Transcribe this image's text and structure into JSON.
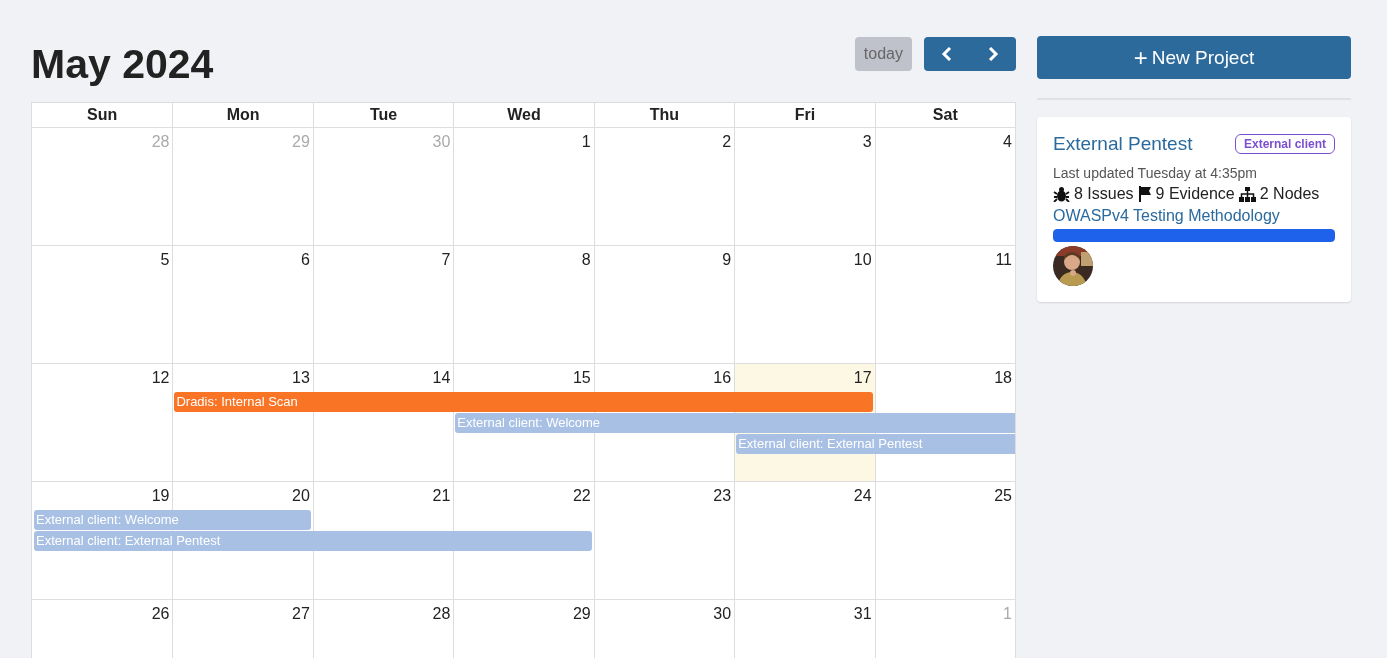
{
  "calendar": {
    "title": "May 2024",
    "today_button": {
      "label": "today",
      "disabled": true
    },
    "weekdays": [
      "Sun",
      "Mon",
      "Tue",
      "Wed",
      "Thu",
      "Fri",
      "Sat"
    ],
    "weeks": [
      {
        "days": [
          {
            "n": "28",
            "other_month": true,
            "today": false
          },
          {
            "n": "29",
            "other_month": true,
            "today": false
          },
          {
            "n": "30",
            "other_month": true,
            "today": false
          },
          {
            "n": "1",
            "other_month": false,
            "today": false
          },
          {
            "n": "2",
            "other_month": false,
            "today": false
          },
          {
            "n": "3",
            "other_month": false,
            "today": false
          },
          {
            "n": "4",
            "other_month": false,
            "today": false
          }
        ]
      },
      {
        "days": [
          {
            "n": "5",
            "other_month": false,
            "today": false
          },
          {
            "n": "6",
            "other_month": false,
            "today": false
          },
          {
            "n": "7",
            "other_month": false,
            "today": false
          },
          {
            "n": "8",
            "other_month": false,
            "today": false
          },
          {
            "n": "9",
            "other_month": false,
            "today": false
          },
          {
            "n": "10",
            "other_month": false,
            "today": false
          },
          {
            "n": "11",
            "other_month": false,
            "today": false
          }
        ]
      },
      {
        "days": [
          {
            "n": "12",
            "other_month": false,
            "today": false
          },
          {
            "n": "13",
            "other_month": false,
            "today": false
          },
          {
            "n": "14",
            "other_month": false,
            "today": false
          },
          {
            "n": "15",
            "other_month": false,
            "today": false
          },
          {
            "n": "16",
            "other_month": false,
            "today": false
          },
          {
            "n": "17",
            "other_month": false,
            "today": true
          },
          {
            "n": "18",
            "other_month": false,
            "today": false
          }
        ],
        "events": [
          {
            "title": "Dradis: Internal Scan",
            "color": "#f97425"
          },
          {
            "title": "External client: Welcome",
            "color": "#a8c0e4"
          },
          {
            "title": "External client: External Pentest",
            "color": "#a8c0e4"
          }
        ]
      },
      {
        "days": [
          {
            "n": "19",
            "other_month": false,
            "today": false
          },
          {
            "n": "20",
            "other_month": false,
            "today": false
          },
          {
            "n": "21",
            "other_month": false,
            "today": false
          },
          {
            "n": "22",
            "other_month": false,
            "today": false
          },
          {
            "n": "23",
            "other_month": false,
            "today": false
          },
          {
            "n": "24",
            "other_month": false,
            "today": false
          },
          {
            "n": "25",
            "other_month": false,
            "today": false
          }
        ],
        "events": [
          {
            "title": "External client: Welcome",
            "color": "#a8c0e4"
          },
          {
            "title": "External client: External Pentest",
            "color": "#a8c0e4"
          }
        ]
      },
      {
        "days": [
          {
            "n": "26",
            "other_month": false,
            "today": false
          },
          {
            "n": "27",
            "other_month": false,
            "today": false
          },
          {
            "n": "28",
            "other_month": false,
            "today": false
          },
          {
            "n": "29",
            "other_month": false,
            "today": false
          },
          {
            "n": "30",
            "other_month": false,
            "today": false
          },
          {
            "n": "31",
            "other_month": false,
            "today": false
          },
          {
            "n": "1",
            "other_month": true,
            "today": false
          }
        ]
      }
    ]
  },
  "new_project_button": {
    "icon": "+",
    "label": "New Project"
  },
  "projects": [
    {
      "name": "External Pentest",
      "tag": "External client",
      "updated": "Last updated Tuesday at 4:35pm",
      "issues": "8 Issues",
      "evidence": "9 Evidence",
      "nodes": "2 Nodes",
      "methodology": "OWASPv4 Testing Methodology",
      "level": 1
    }
  ]
}
